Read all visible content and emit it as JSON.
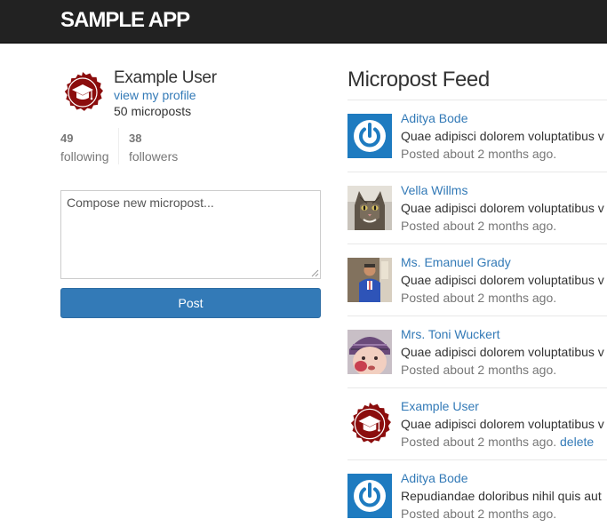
{
  "app": {
    "brand": "sample app"
  },
  "sidebar": {
    "user_name": "Example User",
    "profile_link": "view my profile",
    "micropost_count": "50 microposts",
    "stats": {
      "following_count": "49",
      "following_label": "following",
      "followers_count": "38",
      "followers_label": "followers"
    },
    "composer": {
      "placeholder": "Compose new micropost...",
      "value": ""
    },
    "post_button": "Post"
  },
  "feed": {
    "title": "Micropost Feed",
    "items": [
      {
        "author": "Aditya Bode",
        "content": "Quae adipisci dolorem voluptatibus v",
        "timestamp": "Posted about 2 months ago.",
        "avatar": "power-icon"
      },
      {
        "author": "Vella Willms",
        "content": "Quae adipisci dolorem voluptatibus v",
        "timestamp": "Posted about 2 months ago.",
        "avatar": "cat-photo"
      },
      {
        "author": "Ms. Emanuel Grady",
        "content": "Quae adipisci dolorem voluptatibus v",
        "timestamp": "Posted about 2 months ago.",
        "avatar": "person-photo"
      },
      {
        "author": "Mrs. Toni Wuckert",
        "content": "Quae adipisci dolorem voluptatibus v",
        "timestamp": "Posted about 2 months ago.",
        "avatar": "baby-photo"
      },
      {
        "author": "Example User",
        "content": "Quae adipisci dolorem voluptatibus v",
        "timestamp": "Posted about 2 months ago.",
        "delete": "delete",
        "avatar": "graduation-cap-badge"
      },
      {
        "author": "Aditya Bode",
        "content": "Repudiandae doloribus nihil quis aut",
        "timestamp": "Posted about 2 months ago.",
        "avatar": "power-icon"
      }
    ]
  },
  "colors": {
    "navbar": "#222222",
    "link": "#337ab7",
    "button": "#337ab7",
    "badge": "#8b0d0d",
    "power_avatar": "#1e7bc0",
    "muted": "#777777"
  }
}
